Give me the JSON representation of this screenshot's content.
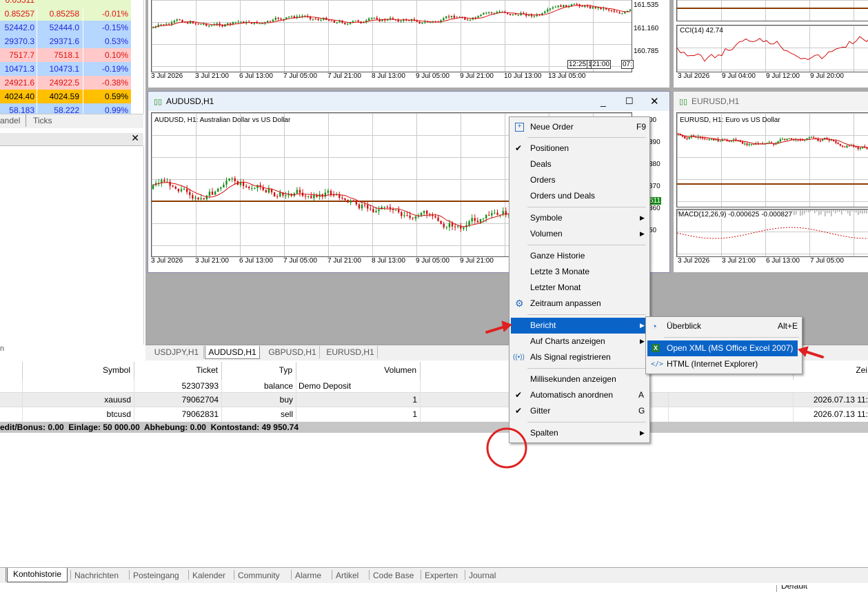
{
  "market_watch": {
    "rows": [
      {
        "bid": "0.85257",
        "ask": "0.85258",
        "change": "-0.01%",
        "bg": "#e6f7c9",
        "color": "#e01010"
      },
      {
        "bid": "52442.0",
        "ask": "52444.0",
        "change": "-0.15%",
        "bg": "#b4d6ff",
        "color": "#2828d8"
      },
      {
        "bid": "29370.3",
        "ask": "29371.6",
        "change": "0.53%",
        "bg": "#b4d6ff",
        "color": "#2828d8"
      },
      {
        "bid": "7517.7",
        "ask": "7518.1",
        "change": "0.10%",
        "bg": "#ffc9c9",
        "color": "#e01010"
      },
      {
        "bid": "10471.3",
        "ask": "10473.1",
        "change": "-0.19%",
        "bg": "#b4d6ff",
        "color": "#2828d8"
      },
      {
        "bid": "24921.6",
        "ask": "24922.5",
        "change": "-0.38%",
        "bg": "#ffc9c9",
        "color": "#e01010"
      },
      {
        "bid": "4024.40",
        "ask": "4024.59",
        "change": "0.59%",
        "bg": "#ffc000",
        "color": "#000000"
      },
      {
        "bid": "58.183",
        "ask": "58.222",
        "change": "0.99%",
        "bg": "#b4d6ff",
        "color": "#2828d8"
      }
    ],
    "tabs": [
      "andel",
      "Ticks"
    ]
  },
  "charts": {
    "top_left": {
      "prices": [
        "161.535",
        "161.160",
        "160.785"
      ],
      "time_labels": [
        "3 Jul 2026",
        "3 Jul 21:00",
        "6 Jul 13:00",
        "7 Jul 05:00",
        "7 Jul 21:00",
        "8 Jul 13:00",
        "9 Jul 05:00",
        "9 Jul 21:00",
        "10 Jul 13:00",
        "13 Jul 05:00"
      ],
      "cursor_labels": [
        "12:25",
        "1",
        "21:00",
        "07:"
      ]
    },
    "top_right": {
      "indicator": "CCI(14) 42.74",
      "time_labels": [
        "3 Jul 2026",
        "9 Jul 04:00",
        "9 Jul 12:00",
        "9 Jul 20:00",
        "10"
      ]
    },
    "audusd": {
      "window_title": "AUDUSD,H1",
      "subtitle": "AUDUSD, H1:  Australian Dollar vs US Dollar",
      "price_labels": [
        "00",
        "390",
        "380",
        "370",
        "360",
        "50"
      ],
      "price_tag": "511",
      "time_labels": [
        "3 Jul 2026",
        "3 Jul 21:00",
        "6 Jul 13:00",
        "7 Jul 05:00",
        "7 Jul 21:00",
        "8 Jul 13:00",
        "9 Jul 05:00",
        "9 Jul 21:00"
      ]
    },
    "eurusd": {
      "window_title": "EURUSD,H1",
      "subtitle": "EURUSD, H1:  Euro vs US Dollar",
      "indicator": "MACD(12,26,9) -0.000625 -0.000827",
      "time_labels": [
        "3 Jul 2026",
        "3 Jul 21:00",
        "6 Jul 13:00",
        "7 Jul 05:00",
        "7 Jul"
      ]
    }
  },
  "chart_tabs": [
    "USDJPY,H1",
    "AUDUSD,H1",
    "GBPUSD,H1",
    "EURUSD,H1"
  ],
  "history_table": {
    "headers": {
      "symbol": "Symbol",
      "ticket": "Ticket",
      "type": "Typ",
      "volume": "Volumen",
      "time": "Zei"
    },
    "rows": [
      {
        "symbol": "",
        "ticket": "52307393",
        "type": "balance",
        "comment": "Demo Deposit",
        "volume": "",
        "time": ""
      },
      {
        "symbol": "xauusd",
        "ticket": "79062704",
        "type": "buy",
        "comment": "",
        "volume": "1",
        "time": "2026.07.13 11:"
      },
      {
        "symbol": "btcusd",
        "ticket": "79062831",
        "type": "sell",
        "comment": "",
        "volume": "1",
        "time": "2026.07.13 11:"
      }
    ],
    "summary": "edit/Bonus: 0.00  Einlage: 50 000.00  Abhebung: 0.00  Kontostand: 49 950.74"
  },
  "bottom_tabs": [
    "Kontohistorie",
    "Nachrichten",
    "Posteingang",
    "Kalender",
    "Community",
    "Alarme",
    "Artikel",
    "Code Base",
    "Experten",
    "Journal"
  ],
  "status_right": "Default",
  "context_menu": {
    "items": [
      {
        "label": "Neue Order",
        "shortcut": "F9",
        "icon": "new-order-icon"
      },
      {
        "label": "Positionen",
        "checked": true
      },
      {
        "label": "Deals"
      },
      {
        "label": "Orders"
      },
      {
        "label": "Orders und Deals"
      },
      {
        "label": "Symbole",
        "submenu": true
      },
      {
        "label": "Volumen",
        "submenu": true
      },
      {
        "label": "Ganze Historie"
      },
      {
        "label": "Letzte 3 Monate"
      },
      {
        "label": "Letzter Monat"
      },
      {
        "label": "Zeitraum anpassen",
        "icon": "gear-icon"
      },
      {
        "label": "Bericht",
        "submenu": true,
        "highlighted": true
      },
      {
        "label": "Auf Charts anzeigen",
        "submenu": true
      },
      {
        "label": "Als Signal registrieren",
        "icon": "signal-icon"
      },
      {
        "label": "Millisekunden anzeigen"
      },
      {
        "label": "Automatisch anordnen",
        "checked": true,
        "shortcut": "A"
      },
      {
        "label": "Gitter",
        "checked": true,
        "shortcut": "G"
      },
      {
        "label": "Spalten",
        "submenu": true
      }
    ]
  },
  "report_submenu": {
    "items": [
      {
        "label": "Überblick",
        "shortcut": "Alt+E",
        "icon": "report-chart-icon"
      },
      {
        "label": "Open XML (MS Office Excel 2007)",
        "icon": "excel-icon",
        "highlighted": true
      },
      {
        "label": "HTML (Internet Explorer)",
        "icon": "html-code-icon"
      }
    ]
  },
  "colors": {
    "accent": "#0a64c8",
    "annotation": "#e02020",
    "candle_up": "#1a8c1a",
    "candle_down": "#d01010",
    "level": "#8b3a00"
  }
}
